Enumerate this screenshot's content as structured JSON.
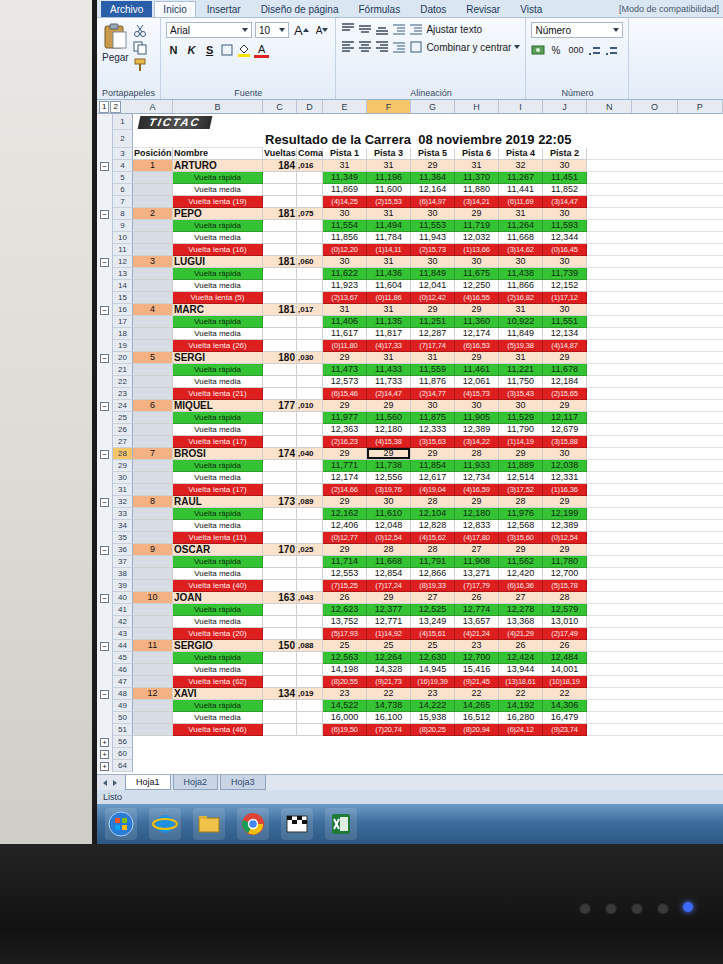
{
  "window": {
    "title": "[Modo de compatibilidad]"
  },
  "ribbon": {
    "tabs": [
      {
        "label": "Archivo",
        "selected": false
      },
      {
        "label": "Inicio",
        "selected": true
      },
      {
        "label": "Insertar",
        "selected": false
      },
      {
        "label": "Diseño de página",
        "selected": false
      },
      {
        "label": "Fórmulas",
        "selected": false
      },
      {
        "label": "Datos",
        "selected": false
      },
      {
        "label": "Revisar",
        "selected": false
      },
      {
        "label": "Vista",
        "selected": false
      }
    ],
    "clipboard": {
      "paste": "Pegar",
      "label": "Portapapeles"
    },
    "font": {
      "name": "Arial",
      "size": "10",
      "grow": "A",
      "shrink": "A",
      "bold": "N",
      "italic": "K",
      "underline": "S",
      "color": "A",
      "label": "Fuente"
    },
    "alignment": {
      "wrap": "Ajustar texto",
      "merge": "Combinar y centrar",
      "label": "Alineación"
    },
    "number": {
      "format": "Número",
      "percent": "%",
      "thousands": "000",
      "label": "Número"
    }
  },
  "outline_levels": [
    "1",
    "2"
  ],
  "sheet": {
    "columns": [
      {
        "letter": "A",
        "selected": false
      },
      {
        "letter": "B",
        "selected": false
      },
      {
        "letter": "C",
        "selected": false
      },
      {
        "letter": "D",
        "selected": false
      },
      {
        "letter": "E",
        "selected": false
      },
      {
        "letter": "F",
        "selected": true
      },
      {
        "letter": "G",
        "selected": false
      },
      {
        "letter": "H",
        "selected": false
      },
      {
        "letter": "I",
        "selected": false
      },
      {
        "letter": "J",
        "selected": false
      },
      {
        "letter": "N",
        "selected": false
      },
      {
        "letter": "O",
        "selected": false
      },
      {
        "letter": "P",
        "selected": false
      }
    ],
    "logo": "TICTAC",
    "title": "Resultado de la Carrera  08 noviembre 2019 22:05",
    "top_rows": [
      {
        "row": "1",
        "selected": false
      },
      {
        "row": "2",
        "selected": false
      },
      {
        "row": "3",
        "selected": false
      }
    ],
    "headers": [
      "Posición",
      "Nombre",
      "Vueltas",
      "Coma",
      "Pista 1",
      "Pista 3",
      "Pista 5",
      "Pista 6",
      "Pista 4",
      "Pista 2"
    ],
    "racers": [
      {
        "row": "4",
        "selected": false,
        "outline": "−",
        "position": "1",
        "name": "ARTURO",
        "laps": "184",
        "decimal": ",016",
        "track_laps": [
          "31",
          "31",
          "29",
          "31",
          "32",
          "30"
        ],
        "rows": [
          {
            "row": "5",
            "selected": false,
            "kind": "fast",
            "label": "Vuelta rápida",
            "values": [
              "11,349",
              "11,196",
              "11,364",
              "11,370",
              "11,267",
              "11,451"
            ]
          },
          {
            "row": "6",
            "selected": false,
            "kind": "avg",
            "label": "Vuelta media",
            "values": [
              "11,869",
              "11,600",
              "12,164",
              "11,880",
              "11,441",
              "11,852"
            ]
          },
          {
            "row": "7",
            "selected": false,
            "kind": "slow",
            "label": "Vuelta lenta (19)",
            "values": [
              "(4)14,25",
              "(2)15,53",
              "(6)14,97",
              "(3)14,21",
              "(6)11,69",
              "(3)14,47"
            ]
          }
        ]
      },
      {
        "row": "8",
        "selected": false,
        "outline": "−",
        "position": "2",
        "name": "PEPO",
        "laps": "181",
        "decimal": ",075",
        "track_laps": [
          "30",
          "31",
          "30",
          "29",
          "31",
          "30"
        ],
        "rows": [
          {
            "row": "9",
            "selected": false,
            "kind": "fast",
            "label": "Vuelta rápida",
            "values": [
              "11,554",
              "11,494",
              "11,553",
              "11,719",
              "11,264",
              "11,593"
            ]
          },
          {
            "row": "10",
            "selected": false,
            "kind": "avg",
            "label": "Vuelta media",
            "values": [
              "11,856",
              "11,784",
              "11,943",
              "12,032",
              "11,668",
              "12,344"
            ]
          },
          {
            "row": "11",
            "selected": false,
            "kind": "slow",
            "label": "Vuelta lenta (16)",
            "values": [
              "(0)12,20",
              "(1)14,11",
              "(2)15,73",
              "(1)13,66",
              "(3)14,62",
              "(0)16,45"
            ]
          }
        ]
      },
      {
        "row": "12",
        "selected": false,
        "outline": "−",
        "position": "3",
        "name": "LUGUI",
        "laps": "181",
        "decimal": ",060",
        "track_laps": [
          "30",
          "31",
          "30",
          "30",
          "30",
          "30"
        ],
        "rows": [
          {
            "row": "13",
            "selected": false,
            "kind": "fast",
            "label": "Vuelta rápida",
            "values": [
              "11,622",
              "11,436",
              "11,849",
              "11,675",
              "11,438",
              "11,739"
            ]
          },
          {
            "row": "14",
            "selected": false,
            "kind": "avg",
            "label": "Vuelta media",
            "values": [
              "11,923",
              "11,604",
              "12,041",
              "12,250",
              "11,866",
              "12,152"
            ]
          },
          {
            "row": "15",
            "selected": false,
            "kind": "slow",
            "label": "Vuelta lenta (5)",
            "values": [
              "(2)13,67",
              "(0)11,86",
              "(0)12,42",
              "(4)16,55",
              "(2)16,82",
              "(1)17,12"
            ]
          }
        ]
      },
      {
        "row": "16",
        "selected": false,
        "outline": "−",
        "position": "4",
        "name": "MARC",
        "laps": "181",
        "decimal": ",017",
        "track_laps": [
          "31",
          "31",
          "29",
          "29",
          "31",
          "30"
        ],
        "rows": [
          {
            "row": "17",
            "selected": false,
            "kind": "fast",
            "label": "Vuelta rápida",
            "values": [
              "11,406",
              "11,135",
              "11,251",
              "11,360",
              "10,922",
              "11,551"
            ]
          },
          {
            "row": "18",
            "selected": false,
            "kind": "avg",
            "label": "Vuelta media",
            "values": [
              "11,617",
              "11,817",
              "12,287",
              "12,174",
              "11,849",
              "12,134"
            ]
          },
          {
            "row": "19",
            "selected": false,
            "kind": "slow",
            "label": "Vuelta lenta (26)",
            "values": [
              "(0)11,80",
              "(4)17,33",
              "(7)17,74",
              "(6)16,53",
              "(5)19,38",
              "(4)14,87"
            ]
          }
        ]
      },
      {
        "row": "20",
        "selected": false,
        "outline": "−",
        "position": "5",
        "name": "SERGI",
        "laps": "180",
        "decimal": ",030",
        "track_laps": [
          "29",
          "31",
          "31",
          "29",
          "31",
          "29"
        ],
        "rows": [
          {
            "row": "21",
            "selected": false,
            "kind": "fast",
            "label": "Vuelta rápida",
            "values": [
              "11,473",
              "11,433",
              "11,559",
              "11,461",
              "11,221",
              "11,678"
            ]
          },
          {
            "row": "22",
            "selected": false,
            "kind": "avg",
            "label": "Vuelta media",
            "values": [
              "12,573",
              "11,733",
              "11,876",
              "12,061",
              "11,750",
              "12,184"
            ]
          },
          {
            "row": "23",
            "selected": false,
            "kind": "slow",
            "label": "Vuelta lenta (21)",
            "values": [
              "(6)15,46",
              "(2)14,47",
              "(2)14,77",
              "(4)15,73",
              "(3)15,43",
              "(2)15,65"
            ]
          }
        ]
      },
      {
        "row": "24",
        "selected": false,
        "outline": "−",
        "position": "6",
        "name": "MIQUEL",
        "laps": "177",
        "decimal": ",010",
        "track_laps": [
          "29",
          "29",
          "30",
          "30",
          "30",
          "29"
        ],
        "rows": [
          {
            "row": "25",
            "selected": false,
            "kind": "fast",
            "label": "Vuelta rápida",
            "values": [
              "11,977",
              "11,560",
              "11,875",
              "11,905",
              "11,529",
              "12,117"
            ]
          },
          {
            "row": "26",
            "selected": false,
            "kind": "avg",
            "label": "Vuelta media",
            "values": [
              "12,363",
              "12,180",
              "12,333",
              "12,389",
              "11,790",
              "12,679"
            ]
          },
          {
            "row": "27",
            "selected": false,
            "kind": "slow",
            "label": "Vuelta lenta (17)",
            "values": [
              "(2)16,23",
              "(4)15,38",
              "(3)15,63",
              "(3)14,22",
              "(1)14,19",
              "(3)15,88"
            ]
          }
        ]
      },
      {
        "row": "28",
        "selected": true,
        "outline": "−",
        "position": "7",
        "name": "BROSI",
        "laps": "174",
        "decimal": ",040",
        "track_laps": [
          "29",
          "29",
          "29",
          "28",
          "29",
          "30"
        ],
        "rows": [
          {
            "row": "29",
            "selected": false,
            "kind": "fast",
            "label": "Vuelta rápida",
            "values": [
              "11,771",
              "11,738",
              "11,854",
              "11,933",
              "11,889",
              "12,038"
            ]
          },
          {
            "row": "30",
            "selected": false,
            "kind": "avg",
            "label": "Vuelta media",
            "values": [
              "12,174",
              "12,556",
              "12,617",
              "12,734",
              "12,514",
              "12,331"
            ]
          },
          {
            "row": "31",
            "selected": false,
            "kind": "slow",
            "label": "Vuelta lenta (17)",
            "values": [
              "(2)14,66",
              "(3)19,76",
              "(4)19,04",
              "(4)16,59",
              "(3)17,52",
              "(1)16,36"
            ]
          }
        ]
      },
      {
        "row": "32",
        "selected": false,
        "outline": "−",
        "position": "8",
        "name": "RAUL",
        "laps": "173",
        "decimal": ",089",
        "track_laps": [
          "29",
          "30",
          "28",
          "29",
          "28",
          "29"
        ],
        "rows": [
          {
            "row": "33",
            "selected": false,
            "kind": "fast",
            "label": "Vuelta rápida",
            "values": [
              "12,162",
              "11,610",
              "12,104",
              "12,180",
              "11,976",
              "12,199"
            ]
          },
          {
            "row": "34",
            "selected": false,
            "kind": "avg",
            "label": "Vuelta media",
            "values": [
              "12,406",
              "12,048",
              "12,828",
              "12,833",
              "12,568",
              "12,389"
            ]
          },
          {
            "row": "35",
            "selected": false,
            "kind": "slow",
            "label": "Vuelta lenta (11)",
            "values": [
              "(0)12,77",
              "(0)12,54",
              "(4)15,62",
              "(4)17,80",
              "(3)15,60",
              "(0)12,54"
            ]
          }
        ]
      },
      {
        "row": "36",
        "selected": false,
        "outline": "−",
        "position": "9",
        "name": "OSCAR",
        "laps": "170",
        "decimal": ",025",
        "track_laps": [
          "29",
          "28",
          "28",
          "27",
          "29",
          "29"
        ],
        "rows": [
          {
            "row": "37",
            "selected": false,
            "kind": "fast",
            "label": "Vuelta rápida",
            "values": [
              "11,714",
              "11,668",
              "11,791",
              "11,908",
              "11,562",
              "11,780"
            ]
          },
          {
            "row": "38",
            "selected": false,
            "kind": "avg",
            "label": "Vuelta media",
            "values": [
              "12,553",
              "12,854",
              "12,866",
              "13,271",
              "12,420",
              "12,700"
            ]
          },
          {
            "row": "39",
            "selected": false,
            "kind": "slow",
            "label": "Vuelta lenta (40)",
            "values": [
              "(7)15,25",
              "(7)17,24",
              "(8)19,33",
              "(7)17,79",
              "(6)16,36",
              "(5)15,78"
            ]
          }
        ]
      },
      {
        "row": "40",
        "selected": false,
        "outline": "−",
        "position": "10",
        "name": "JOAN",
        "laps": "163",
        "decimal": ",043",
        "track_laps": [
          "26",
          "29",
          "27",
          "26",
          "27",
          "28"
        ],
        "rows": [
          {
            "row": "41",
            "selected": false,
            "kind": "fast",
            "label": "Vuelta rápida",
            "values": [
              "12,623",
              "12,377",
              "12,525",
              "12,774",
              "12,278",
              "12,579"
            ]
          },
          {
            "row": "42",
            "selected": false,
            "kind": "avg",
            "label": "Vuelta media",
            "values": [
              "13,752",
              "12,771",
              "13,249",
              "13,657",
              "13,368",
              "13,010"
            ]
          },
          {
            "row": "43",
            "selected": false,
            "kind": "slow",
            "label": "Vuelta lenta (20)",
            "values": [
              "(5)17,93",
              "(1)14,92",
              "(4)15,61",
              "(4)21,24",
              "(4)21,29",
              "(2)17,49"
            ]
          }
        ]
      },
      {
        "row": "44",
        "selected": false,
        "outline": "−",
        "position": "11",
        "name": "SERGIO",
        "laps": "150",
        "decimal": ",088",
        "track_laps": [
          "25",
          "25",
          "25",
          "23",
          "26",
          "26"
        ],
        "rows": [
          {
            "row": "45",
            "selected": false,
            "kind": "fast",
            "label": "Vuelta rápida",
            "values": [
              "12,563",
              "12,264",
              "12,630",
              "12,700",
              "12,424",
              "12,484"
            ]
          },
          {
            "row": "46",
            "selected": false,
            "kind": "avg",
            "label": "Vuelta media",
            "values": [
              "14,198",
              "14,328",
              "14,945",
              "15,416",
              "13,944",
              "14,001"
            ]
          },
          {
            "row": "47",
            "selected": false,
            "kind": "slow",
            "label": "Vuelta lenta (62)",
            "values": [
              "(8)20,55",
              "(9)21,73",
              "(16)19,39",
              "(9)21,45",
              "(13)18,61",
              "(10)18,19"
            ]
          }
        ]
      },
      {
        "row": "48",
        "selected": false,
        "outline": "−",
        "position": "12",
        "name": "XAVI",
        "laps": "134",
        "decimal": ",019",
        "track_laps": [
          "23",
          "22",
          "23",
          "22",
          "22",
          "22"
        ],
        "rows": [
          {
            "row": "49",
            "selected": false,
            "kind": "fast",
            "label": "Vuelta rápida",
            "values": [
              "14,522",
              "14,738",
              "14,222",
              "14,265",
              "14,192",
              "14,306"
            ]
          },
          {
            "row": "50",
            "selected": false,
            "kind": "avg",
            "label": "Vuelta media",
            "values": [
              "16,000",
              "16,100",
              "15,938",
              "16,512",
              "16,280",
              "16,479"
            ]
          },
          {
            "row": "51",
            "selected": false,
            "kind": "slow",
            "label": "Vuelta lenta (46)",
            "values": [
              "(6)19,50",
              "(7)20,74",
              "(8)20,25",
              "(8)20,94",
              "(6)24,12",
              "(9)23,74"
            ]
          }
        ]
      }
    ],
    "footer_rows": [
      {
        "row": "56",
        "selected": false,
        "outline": "+"
      },
      {
        "row": "60",
        "selected": false,
        "outline": "+"
      },
      {
        "row": "64",
        "selected": false,
        "outline": "+"
      }
    ]
  },
  "sheet_tabs": [
    {
      "label": "Hoja1",
      "selected": true
    },
    {
      "label": "Hoja2",
      "selected": false
    },
    {
      "label": "Hoja3",
      "selected": false
    }
  ],
  "status_bar": {
    "text": "Listo"
  }
}
